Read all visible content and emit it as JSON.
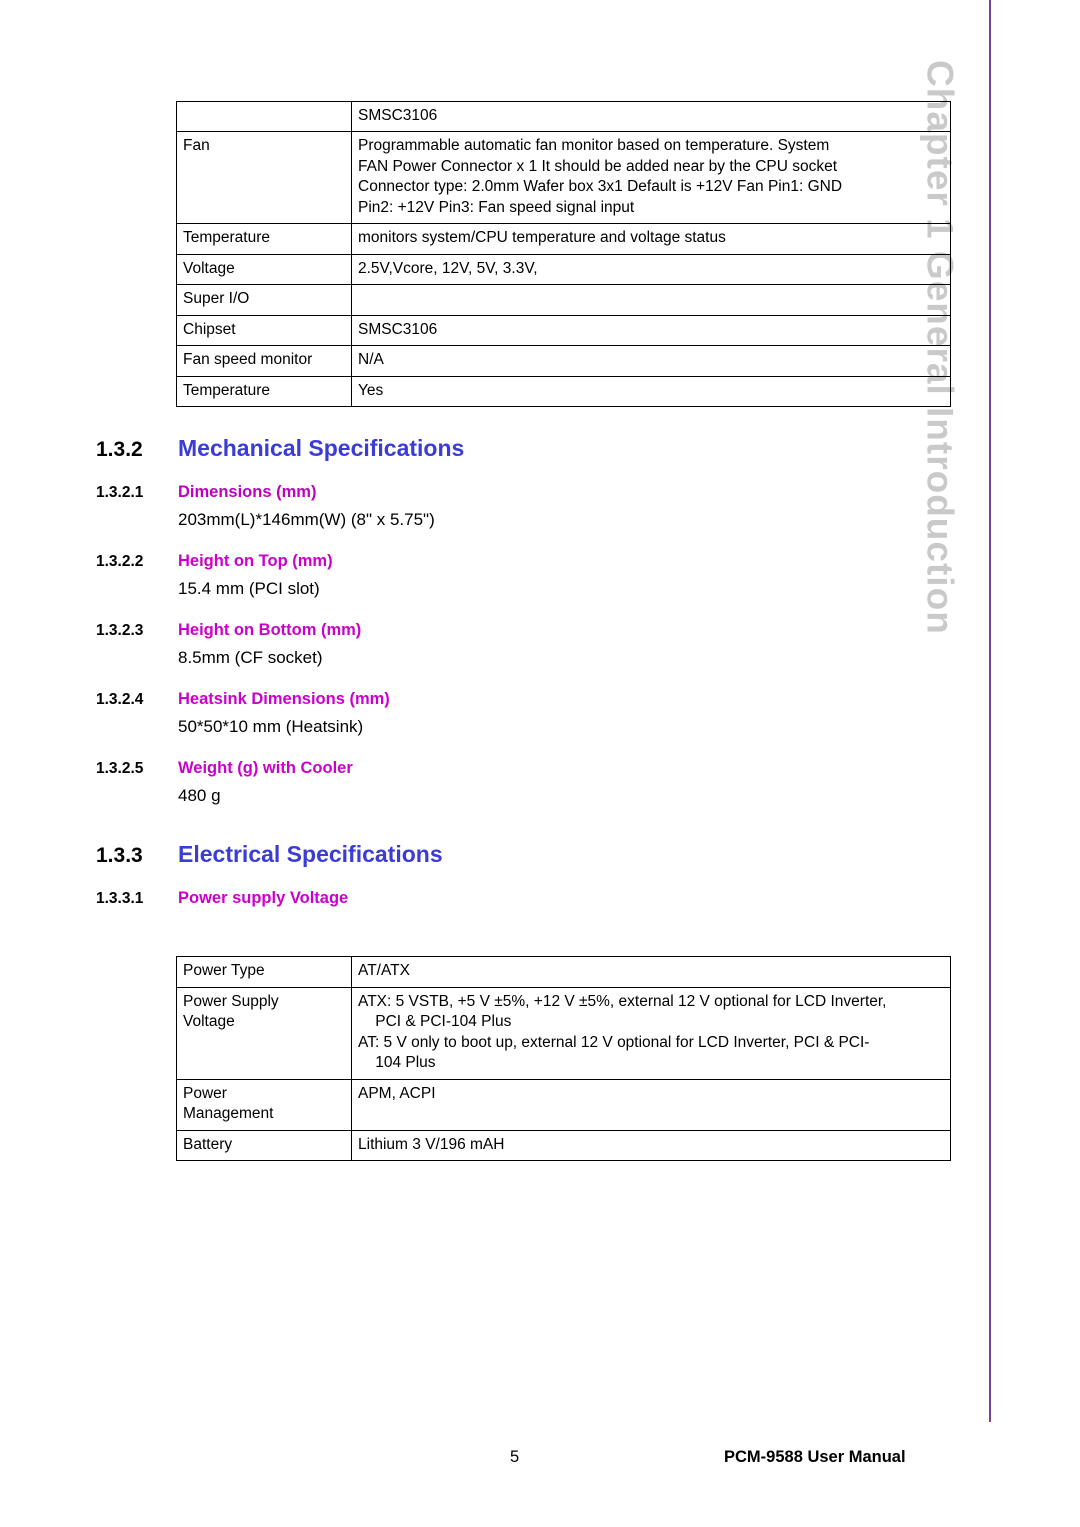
{
  "chapter_banner": "Chapter 1    General Introduction",
  "table_top": {
    "rows": [
      {
        "label": "",
        "lines": [
          "SMSC3106"
        ]
      },
      {
        "label": "Fan",
        "lines": [
          "Programmable automatic fan monitor based on temperature. System",
          "FAN Power Connector x 1 It should be added near by the CPU socket",
          "Connector type: 2.0mm Wafer box 3x1 Default is +12V Fan Pin1: GND",
          "Pin2: +12V Pin3: Fan speed signal input"
        ]
      },
      {
        "label": "Temperature",
        "lines": [
          "monitors system/CPU temperature and voltage status"
        ]
      },
      {
        "label": "Voltage",
        "lines": [
          "2.5V,Vcore, 12V, 5V, 3.3V,"
        ]
      },
      {
        "label": "Super I/O",
        "lines": [
          ""
        ]
      },
      {
        "label": "Chipset",
        "lines": [
          "SMSC3106"
        ]
      },
      {
        "label": "Fan speed monitor",
        "lines": [
          "N/A"
        ]
      },
      {
        "label": "Temperature",
        "lines": [
          "Yes"
        ]
      }
    ]
  },
  "section_mech": {
    "number": "1.3.2",
    "title": "Mechanical Specifications",
    "subsections": [
      {
        "number": "1.3.2.1",
        "title": "Dimensions (mm)",
        "body": "203mm(L)*146mm(W) (8\" x 5.75\")"
      },
      {
        "number": "1.3.2.2",
        "title": "Height on Top (mm)",
        "body": "15.4 mm (PCI slot)"
      },
      {
        "number": "1.3.2.3",
        "title": "Height on Bottom (mm)",
        "body": "8.5mm (CF socket)"
      },
      {
        "number": "1.3.2.4",
        "title": "Heatsink Dimensions (mm)",
        "body": "50*50*10 mm (Heatsink)"
      },
      {
        "number": "1.3.2.5",
        "title": "Weight (g) with Cooler",
        "body": "480 g"
      }
    ]
  },
  "section_elec": {
    "number": "1.3.3",
    "title": "Electrical Specifications",
    "subsection": {
      "number": "1.3.3.1",
      "title": "Power supply Voltage"
    }
  },
  "table_power": {
    "rows": [
      {
        "label_lines": [
          "Power Type"
        ],
        "lines": [
          "AT/ATX"
        ]
      },
      {
        "label_lines": [
          "Power Supply",
          "Voltage"
        ],
        "lines": [
          "ATX: 5 VSTB, +5 V ±5%, +12 V ±5%, external 12 V optional for LCD Inverter,",
          "    PCI & PCI-104 Plus",
          "AT: 5 V only to boot up, external 12 V optional for LCD Inverter, PCI & PCI-",
          "    104 Plus"
        ]
      },
      {
        "label_lines": [
          "Power",
          "Management"
        ],
        "lines": [
          "APM, ACPI"
        ]
      },
      {
        "label_lines": [
          "Battery"
        ],
        "lines": [
          "Lithium 3 V/196 mAH"
        ]
      }
    ]
  },
  "footer": {
    "page_number": "5",
    "manual_title": "PCM-9588 User Manual"
  }
}
